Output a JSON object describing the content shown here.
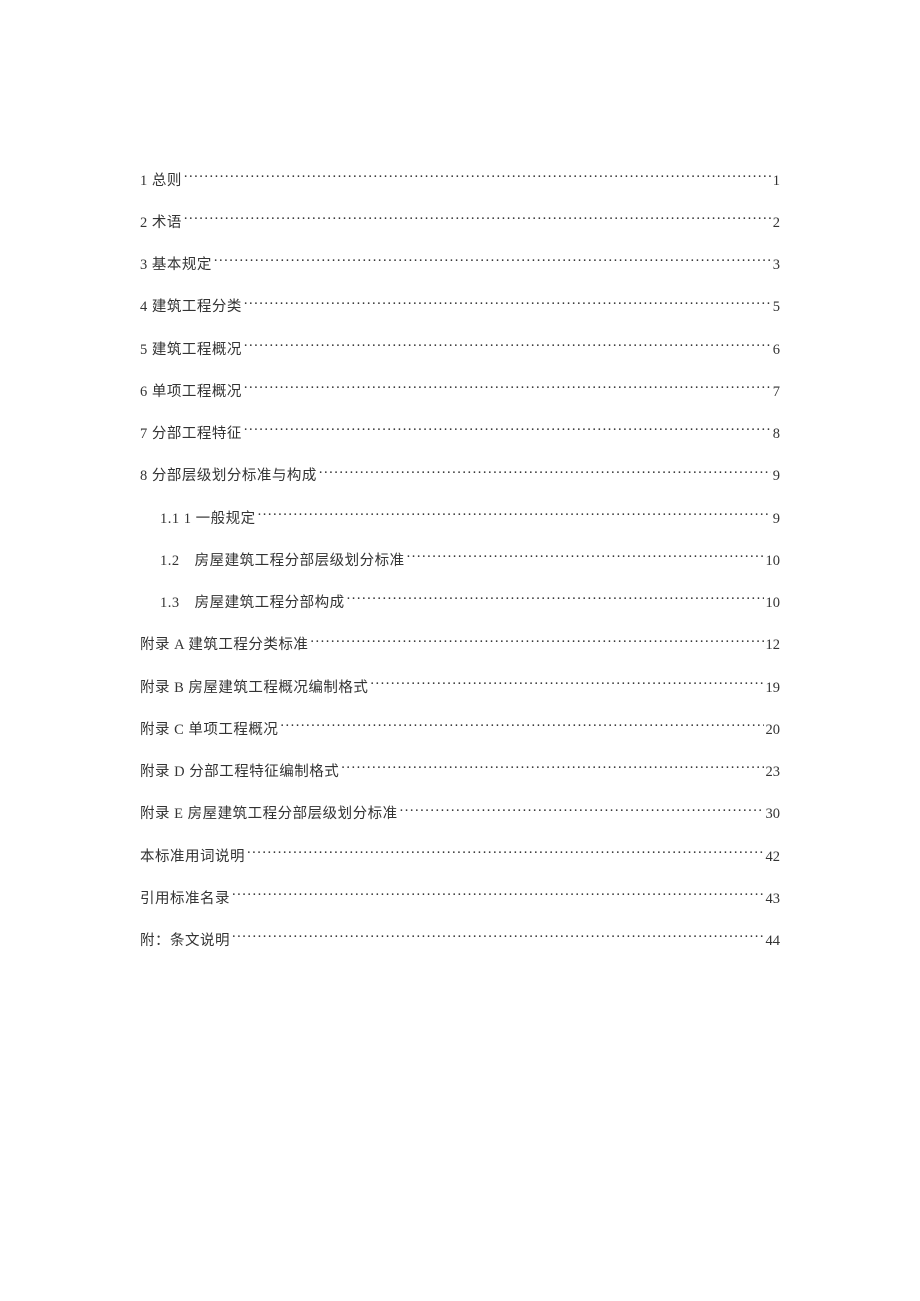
{
  "toc": [
    {
      "title": "1 总则",
      "page": "1",
      "indent": false
    },
    {
      "title": "2 术语",
      "page": "2",
      "indent": false
    },
    {
      "title": "3 基本规定",
      "page": "3",
      "indent": false
    },
    {
      "title": "4 建筑工程分类",
      "page": "5",
      "indent": false
    },
    {
      "title": "5 建筑工程概况",
      "page": "6",
      "indent": false
    },
    {
      "title": "6 单项工程概况",
      "page": "7",
      "indent": false
    },
    {
      "title": "7 分部工程特征",
      "page": "8",
      "indent": false
    },
    {
      "title": "8 分部层级划分标准与构成",
      "page": "9",
      "indent": false
    },
    {
      "title": "1.1 1 一般规定",
      "page": "9",
      "indent": true
    },
    {
      "title": "1.2　房屋建筑工程分部层级划分标准",
      "page": "10",
      "indent": true
    },
    {
      "title": "1.3　房屋建筑工程分部构成",
      "page": "10",
      "indent": true
    },
    {
      "title": "附录 A 建筑工程分类标准",
      "page": "12",
      "indent": false
    },
    {
      "title": "附录 B 房屋建筑工程概况编制格式",
      "page": "19",
      "indent": false
    },
    {
      "title": "附录 C 单项工程概况",
      "page": "20",
      "indent": false
    },
    {
      "title": "附录 D 分部工程特征编制格式",
      "page": "23",
      "indent": false
    },
    {
      "title": "附录 E 房屋建筑工程分部层级划分标准",
      "page": "30",
      "indent": false
    },
    {
      "title": "本标准用词说明",
      "page": "42",
      "indent": false
    },
    {
      "title": "引用标准名录",
      "page": "43",
      "indent": false
    },
    {
      "title": "附：条文说明",
      "page": "44",
      "indent": false
    }
  ]
}
